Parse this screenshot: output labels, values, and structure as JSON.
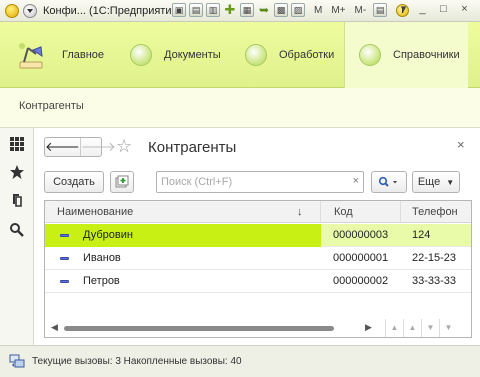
{
  "titlebar": {
    "title": "Конфи... (1С:Предприятие)",
    "memory_buttons": [
      "M",
      "M+",
      "M-"
    ]
  },
  "sections": [
    {
      "label": "Главное",
      "icon": "desk-lamp-icon"
    },
    {
      "label": "Документы",
      "icon": "section-circle-icon"
    },
    {
      "label": "Обработки",
      "icon": "section-circle-icon"
    },
    {
      "label": "Справочники",
      "icon": "section-circle-icon",
      "active": true
    }
  ],
  "open_windows": {
    "current": "Контрагенты"
  },
  "tools": [
    "grid-menu-icon",
    "favorites-star-icon",
    "history-icon",
    "search-icon"
  ],
  "form": {
    "title": "Контрагенты",
    "close": "×",
    "nav": {
      "back": "🡐",
      "forward": "🡒"
    },
    "create_label": "Создать",
    "search_placeholder": "Поиск (Ctrl+F)",
    "search_value": "",
    "search_clear": "×",
    "more_label": "Еще"
  },
  "table": {
    "columns": [
      "Наименование",
      "Код",
      "Телефон"
    ],
    "sort_indicator": "↓",
    "rows": [
      {
        "name": "Дубровин",
        "code": "000000003",
        "phone": "124",
        "selected": true
      },
      {
        "name": "Иванов",
        "code": "000000001",
        "phone": "22-15-23"
      },
      {
        "name": "Петров",
        "code": "000000002",
        "phone": "33-33-33"
      }
    ]
  },
  "status": {
    "text": "Текущие вызовы: 3   Накопленные вызовы: 40"
  },
  "colors": {
    "sections_bg": "#e6f693",
    "selected_row": "#e9fba8",
    "selected_cell": "#c8f014"
  }
}
